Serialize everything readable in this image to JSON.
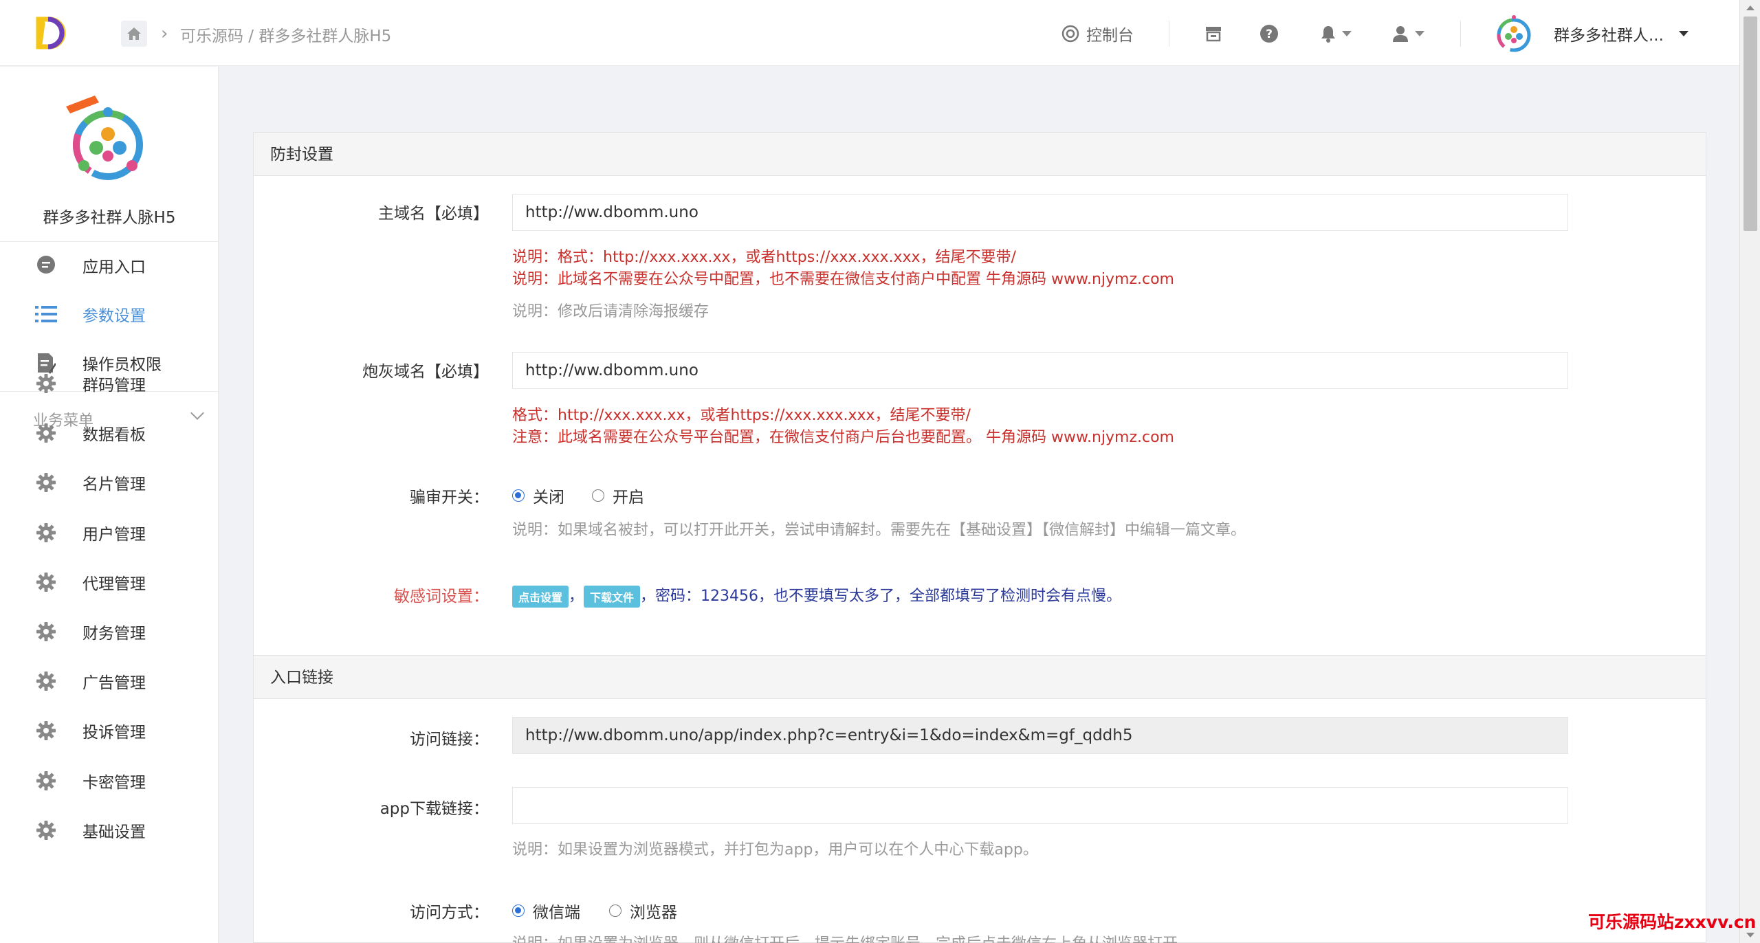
{
  "topbar": {
    "breadcrumb": "可乐源码 / 群多多社群人脉H5",
    "console_label": "控制台",
    "user_name": "群多多社群人..."
  },
  "sidebar": {
    "app_name": "群多多社群人脉H5",
    "items": [
      {
        "label": "应用入口",
        "icon": "chat-icon"
      },
      {
        "label": "参数设置",
        "icon": "list-icon",
        "active": true
      },
      {
        "label": "操作员权限",
        "icon": "edit-doc-icon"
      }
    ],
    "group_title": "业务菜单",
    "menu": [
      {
        "label": "群码管理",
        "icon": "gear-icon"
      },
      {
        "label": "数据看板",
        "icon": "gear-icon"
      },
      {
        "label": "名片管理",
        "icon": "gear-icon"
      },
      {
        "label": "用户管理",
        "icon": "gear-icon"
      },
      {
        "label": "代理管理",
        "icon": "gear-icon"
      },
      {
        "label": "财务管理",
        "icon": "gear-icon"
      },
      {
        "label": "广告管理",
        "icon": "gear-icon"
      },
      {
        "label": "投诉管理",
        "icon": "gear-icon"
      },
      {
        "label": "卡密管理",
        "icon": "gear-icon"
      },
      {
        "label": "基础设置",
        "icon": "gear-icon"
      }
    ]
  },
  "anti_ban": {
    "section_title": "防封设置",
    "main_domain": {
      "label": "主域名【必填】",
      "value": "http://ww.dbomm.uno",
      "help1": "说明：格式：http://xxx.xxx.xx，或者https://xxx.xxx.xxx，结尾不要带/",
      "help2": "说明：此域名不需要在公众号中配置，也不需要在微信支付商户中配置 牛角源码 www.njymz.com",
      "help3": "说明：修改后请清除海报缓存"
    },
    "cannon_domain": {
      "label": "炮灰域名【必填】",
      "value": "http://ww.dbomm.uno",
      "help1": "格式：http://xxx.xxx.xx，或者https://xxx.xxx.xxx，结尾不要带/",
      "help2": "注意：此域名需要在公众号平台配置，在微信支付商户后台也要配置。 牛角源码 www.njymz.com"
    },
    "review_switch": {
      "label": "骗审开关：",
      "options": [
        "关闭",
        "开启"
      ],
      "selected": "关闭",
      "help": "说明：如果域名被封，可以打开此开关，尝试申请解封。需要先在【基础设置】【微信解封】中编辑一篇文章。"
    },
    "sensitive": {
      "label": "敏感词设置：",
      "btn_set": "点击设置",
      "sep1": "，",
      "btn_download": "下载文件",
      "text": "，密码：123456，也不要填写太多了，全部都填写了检测时会有点慢。"
    }
  },
  "entry": {
    "section_title": "入口链接",
    "visit_link": {
      "label": "访问链接：",
      "value": "http://ww.dbomm.uno/app/index.php?c=entry&i=1&do=index&m=gf_qddh5"
    },
    "app_download": {
      "label": "app下载链接：",
      "value": "",
      "help": "说明：如果设置为浏览器模式，并打包为app，用户可以在个人中心下载app。"
    },
    "visit_mode": {
      "label": "访问方式：",
      "options": [
        "微信端",
        "浏览器"
      ],
      "selected": "微信端",
      "help": "说明：如果设置为浏览器，则从微信打开后，提示先绑定账号，完成后点击微信右上角从浏览器打开"
    }
  },
  "watermark": "可乐源码站zxxvv.cn",
  "colors": {
    "accent": "#4a90d9",
    "help_red": "#c9302c",
    "badge": "#5bc0de"
  }
}
